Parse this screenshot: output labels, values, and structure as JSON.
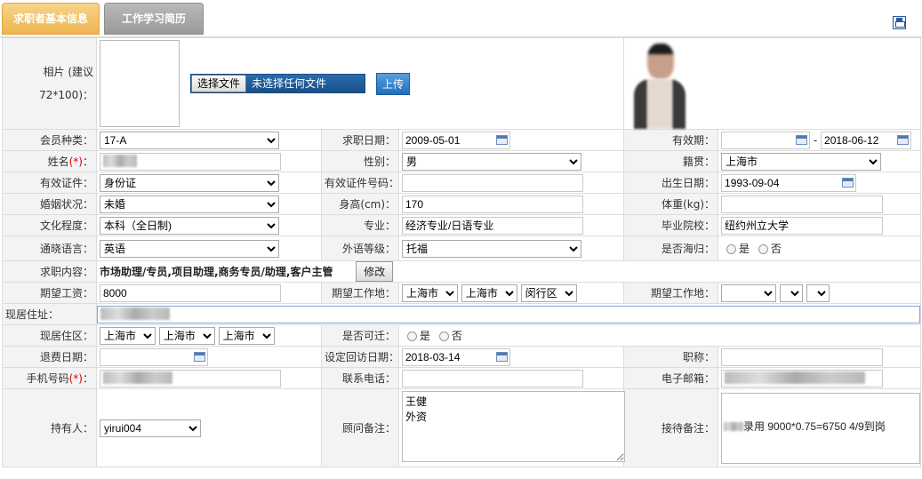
{
  "tabs": [
    {
      "label": "求职者基本信息"
    },
    {
      "label": "工作学习简历"
    }
  ],
  "photo": {
    "label": "相片 (建议72*100)：",
    "choose_file": "选择文件",
    "no_file": "未选择任何文件",
    "upload": "上传"
  },
  "member_type": {
    "label": "会员种类：",
    "value": "17-A"
  },
  "apply_date": {
    "label": "求职日期：",
    "value": "2009-05-01"
  },
  "valid_period": {
    "label": "有效期：",
    "start": "",
    "sep": "-",
    "end": "2018-06-12"
  },
  "name": {
    "label_text": "姓名",
    "label_req": "(*)",
    "label_colon": "："
  },
  "gender": {
    "label": "性别：",
    "value": "男"
  },
  "native_place": {
    "label": "籍贯：",
    "value": "上海市"
  },
  "id_type": {
    "label": "有效证件：",
    "value": "身份证"
  },
  "id_number": {
    "label": "有效证件号码：",
    "value": ""
  },
  "birth_date": {
    "label": "出生日期：",
    "value": "1993-09-04"
  },
  "marital": {
    "label": "婚姻状况：",
    "value": "未婚"
  },
  "height": {
    "label": "身高(cm)：",
    "value": "170"
  },
  "weight": {
    "label": "体重(kg)：",
    "value": ""
  },
  "education": {
    "label": "文化程度：",
    "value": "本科（全日制)"
  },
  "major": {
    "label": "专业：",
    "value": "经济专业/日语专业"
  },
  "school": {
    "label": "毕业院校：",
    "value": "纽约州立大学"
  },
  "language": {
    "label": "通晓语言：",
    "value": "英语"
  },
  "foreign_level": {
    "label": "外语等级：",
    "value": "托福"
  },
  "overseas": {
    "label": "是否海归：",
    "yes": "是",
    "no": "否"
  },
  "job_content": {
    "label": "求职内容：",
    "value": "市场助理/专员,项目助理,商务专员/助理,客户主管",
    "edit": "修改"
  },
  "salary": {
    "label": "期望工资：",
    "value": "8000"
  },
  "work_place1": {
    "label": "期望工作地：",
    "province": "上海市",
    "city": "上海市",
    "district": "闵行区"
  },
  "work_place2": {
    "label": "期望工作地：",
    "province": "",
    "city": "",
    "district": ""
  },
  "address": {
    "label": "现居住址："
  },
  "residence": {
    "label": "现居住区：",
    "province": "上海市",
    "city": "上海市",
    "district": "上海市"
  },
  "relocate": {
    "label": "是否可迁：",
    "yes": "是",
    "no": "否"
  },
  "refund_date": {
    "label": "退费日期：",
    "value": ""
  },
  "revisit_date": {
    "label": "设定回访日期：",
    "value": "2018-03-14"
  },
  "title": {
    "label": "职称：",
    "value": ""
  },
  "mobile": {
    "label_text": "手机号码",
    "label_req": "(*)",
    "label_colon": "："
  },
  "phone": {
    "label": "联系电话：",
    "value": ""
  },
  "email": {
    "label": "电子邮箱："
  },
  "holder": {
    "label": "持有人：",
    "value": "yirui004"
  },
  "consultant_note": {
    "label": "顾问备注：",
    "value": "王健\n外资"
  },
  "reception_note": {
    "label": "接待备注：",
    "value": "录用  9000*0.75=6750  4/9到岗"
  },
  "colors": {
    "tab_active": "#eeb550",
    "tab_inactive": "#9a9a9a",
    "label_bg": "#f3f3f3",
    "accent": "#1f6fbf"
  }
}
